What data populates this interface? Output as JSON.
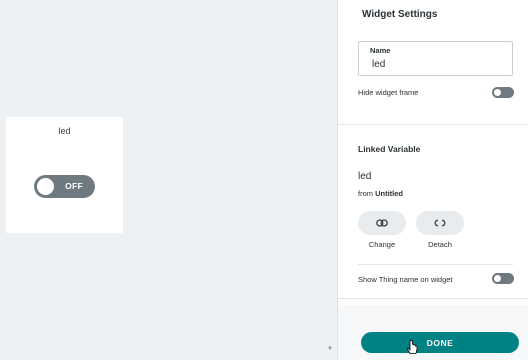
{
  "canvas": {
    "widget": {
      "title": "led",
      "switch_state_label": "OFF"
    }
  },
  "panel": {
    "title": "Widget Settings",
    "name_field": {
      "label": "Name",
      "value": "led"
    },
    "hide_frame": {
      "label": "Hide widget frame",
      "checked": false
    },
    "linked_variable": {
      "section_title": "Linked Variable",
      "variable_name": "led",
      "from_prefix": "from",
      "thing_name": "Untitled",
      "change_label": "Change",
      "detach_label": "Detach"
    },
    "show_thing_name": {
      "label": "Show Thing name on widget",
      "checked": false
    },
    "done_label": "DONE"
  },
  "icons": [
    "link-icon",
    "unlink-icon",
    "scroll-down-arrow-icon",
    "pointer-cursor-icon"
  ],
  "colors": {
    "accent": "#008184",
    "toggle_off": "#6e7a80",
    "canvas_bg": "#eef1f3"
  }
}
